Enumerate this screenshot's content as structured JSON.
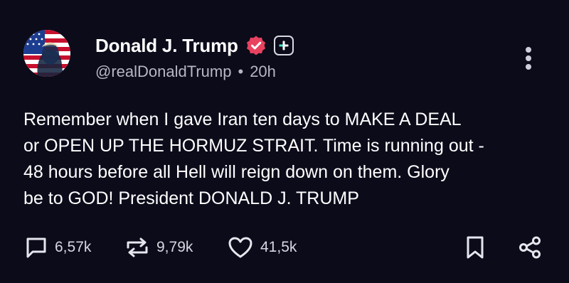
{
  "author": {
    "display_name": "Donald J. Trump",
    "handle": "@realDonaldTrump",
    "time_ago": "20h",
    "separator": "•"
  },
  "post": {
    "lines": [
      "Remember when I gave Iran ten days to MAKE A DEAL",
      "or OPEN UP THE HORMUZ STRAIT. Time is running out -",
      "48 hours before all Hell will reign down on them. Glory",
      "be to GOD! President DONALD J. TRUMP"
    ]
  },
  "actions": {
    "replies": "6,57k",
    "reposts": "9,79k",
    "likes": "41,5k"
  },
  "icons": {
    "verified": "verified-badge-icon",
    "follow": "plus-icon",
    "more": "more-vertical-icon",
    "reply": "comment-icon",
    "repost": "repost-icon",
    "like": "heart-icon",
    "bookmark": "bookmark-icon",
    "share": "share-icon"
  },
  "colors": {
    "background": "#0c0b1a",
    "verified": "#e8425f",
    "secondary_text": "#b7b7c4"
  }
}
